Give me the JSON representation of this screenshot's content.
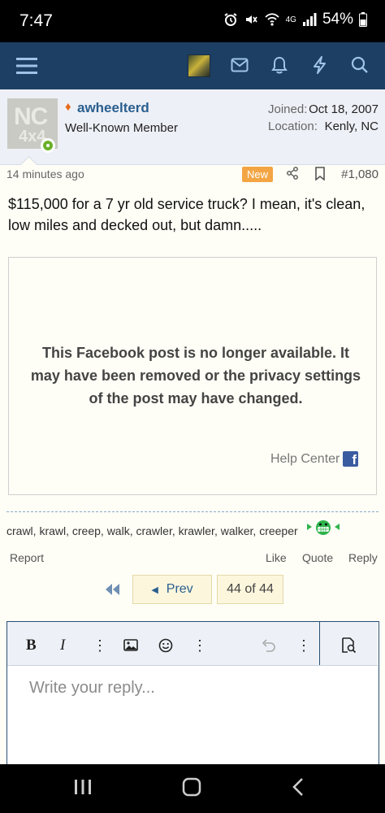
{
  "status_bar": {
    "time": "7:47",
    "network": "4G",
    "battery": "54%"
  },
  "nav": {
    "icons": [
      "menu-icon",
      "avatar",
      "mail-icon",
      "bell-icon",
      "lightning-icon",
      "search-icon"
    ],
    "bg_color": "#1c3f63"
  },
  "member": {
    "avatar_text_line1": "NC",
    "avatar_text_line2": "4x4",
    "username": "awheelterd",
    "user_title": "Well-Known Member",
    "joined_label": "Joined:",
    "joined_value": "Oct 18, 2007",
    "location_label": "Location:",
    "location_value": "Kenly, NC",
    "online": true
  },
  "post": {
    "time": "14 minutes ago",
    "new_badge": "New",
    "number": "#1,080",
    "body": "$115,000 for a 7 yr old service truck? I mean, it's clean, low miles and decked out, but damn.....",
    "embed_message": "This Facebook post is no longer available. It may have been removed or the privacy settings of the post may have changed.",
    "help_center": "Help Center",
    "fb_logo": "f",
    "signature": "crawl, krawl, creep, walk, crawler, krawler, walker, creeper",
    "actions": {
      "report": "Report",
      "like": "Like",
      "quote": "Quote",
      "reply": "Reply"
    }
  },
  "pagination": {
    "prev_label": "Prev",
    "page_indicator": "44 of 44"
  },
  "editor": {
    "bold_label": "B",
    "italic_label": "I",
    "placeholder": "Write your reply..."
  },
  "colors": {
    "link": "#2a5f8f",
    "new_badge": "#f3a544",
    "online": "#6bb12a",
    "accent_flame": "#e76b1b"
  }
}
